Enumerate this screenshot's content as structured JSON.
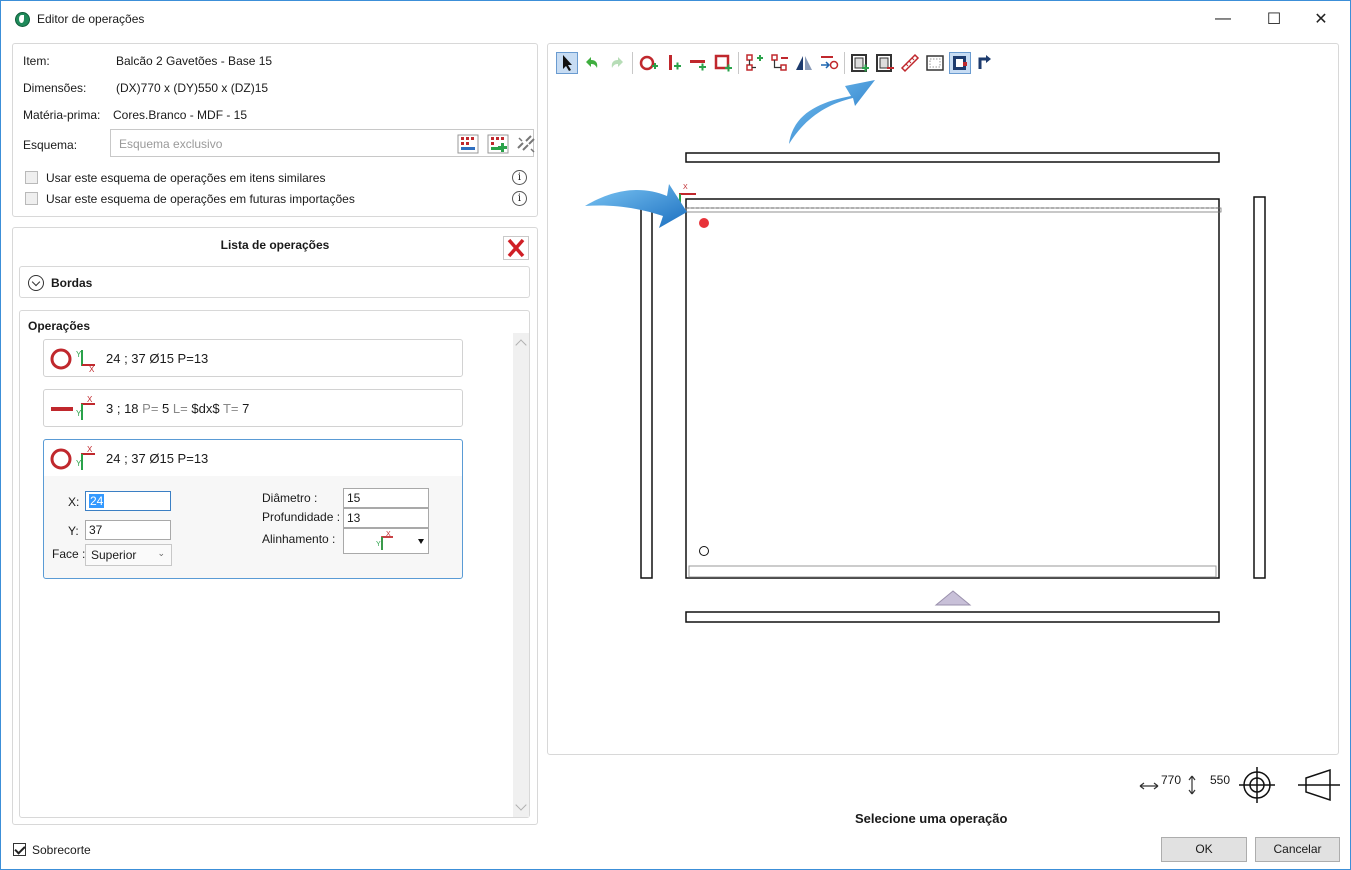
{
  "window": {
    "title": "Editor de operações",
    "minimize": "—",
    "maximize": "☐",
    "close": "✕"
  },
  "info": {
    "item_label": "Item:",
    "item_value": "Balcão 2 Gavetões - Base 15",
    "dims_label": "Dimensões:",
    "dims_value": "(DX)770 x (DY)550 x (DZ)15",
    "material_label": "Matéria-prima:",
    "material_value": "Cores.Branco - MDF - 15",
    "schema_label": "Esquema:",
    "schema_placeholder": "Esquema exclusivo",
    "check_similar": "Usar este esquema de operações em itens similares",
    "check_future": "Usar este esquema de operações em futuras importações",
    "info_glyph": "i"
  },
  "ops": {
    "title": "Lista de operações",
    "bordas": "Bordas",
    "operacoes": "Operações",
    "items": [
      {
        "text": "24 ; 37 Ø15 P=13"
      },
      {
        "coords": "3 ; 18",
        "p_label": "P=",
        "p_value": "5",
        "l_label": "L=",
        "l_value": "$dx$",
        "t_label": "T=",
        "t_value": "7"
      },
      {
        "text": "24 ; 37 Ø15 P=13"
      }
    ],
    "editor": {
      "x_label": "X:",
      "x_value": "24",
      "y_label": "Y:",
      "y_value": "37",
      "face_label": "Face :",
      "face_value": "Superior",
      "diam_label": "Diâmetro :",
      "diam_value": "15",
      "prof_label": "Profundidade :",
      "prof_value": "13",
      "align_label": "Alinhamento :"
    }
  },
  "footer": {
    "sobrecorte": "Sobrecorte",
    "dim_x": "770",
    "dim_y": "550",
    "status": "Selecione uma operação",
    "ok": "OK",
    "cancel": "Cancelar"
  },
  "colors": {
    "accent_blue": "#2f8fd8",
    "red_op": "#c0282d",
    "green_axis": "#2aa24a",
    "panel_fill": "#c8c0d8"
  }
}
